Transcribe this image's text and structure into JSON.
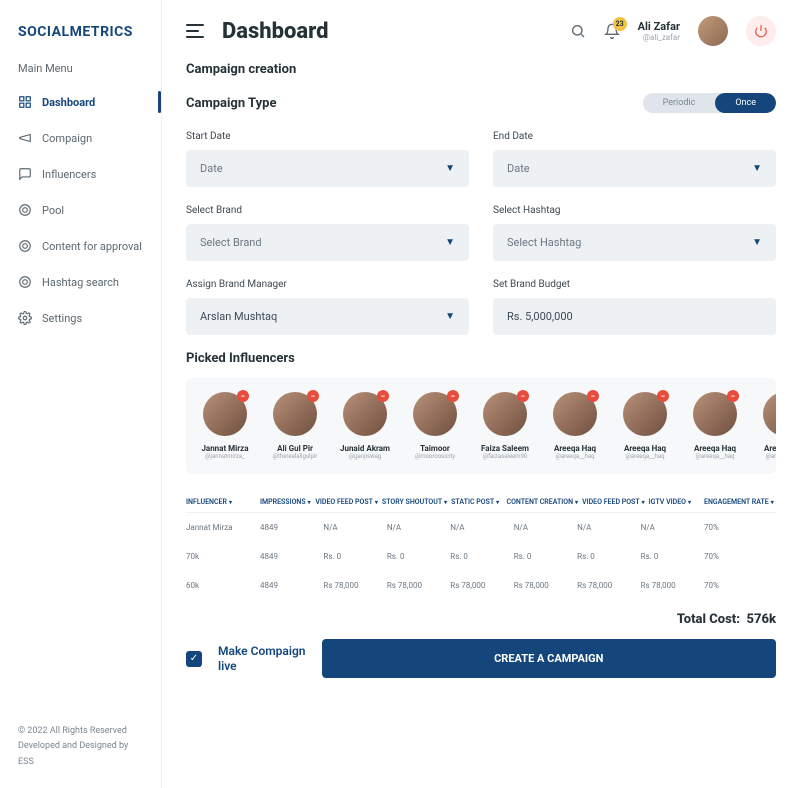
{
  "brand": "SOCIALMETRICS",
  "menu_header": "Main Menu",
  "nav": [
    {
      "label": "Dashboard"
    },
    {
      "label": "Compaign"
    },
    {
      "label": "Influencers"
    },
    {
      "label": "Pool"
    },
    {
      "label": "Content for approval"
    },
    {
      "label": "Hashtag search"
    },
    {
      "label": "Settings"
    }
  ],
  "footer": {
    "copyright": "© 2022 All Rights Reserved",
    "credit": "Developed and Designed by ESS"
  },
  "title": "Dashboard",
  "notifications": "23",
  "user": {
    "name": "Ali Zafar",
    "handle": "@ali_zafar"
  },
  "subtitle": "Campaign creation",
  "section": "Campaign Type",
  "toggle": {
    "a": "Periodic",
    "b": "Once"
  },
  "fields": {
    "start": {
      "label": "Start Date",
      "value": "Date"
    },
    "end": {
      "label": "End Date",
      "value": "Date"
    },
    "brand": {
      "label": "Select Brand",
      "value": "Select Brand"
    },
    "hashtag": {
      "label": "Select Hashtag",
      "value": "Select Hashtag"
    },
    "manager": {
      "label": "Assign Brand Manager",
      "value": "Arslan Mushtaq"
    },
    "budget": {
      "label": "Set Brand Budget",
      "value": "Rs. 5,000,000"
    }
  },
  "picked_label": "Picked Influencers",
  "infl": [
    {
      "name": "Jannat Mirza",
      "handle": "@jannatmirza_"
    },
    {
      "name": "Ali Gul Pir",
      "handle": "@therealaligulpir"
    },
    {
      "name": "Junaid Akram",
      "handle": "@ganjiswag"
    },
    {
      "name": "Taimoor",
      "handle": "@mooroosicity"
    },
    {
      "name": "Faiza Saleem",
      "handle": "@faizasaleem90"
    },
    {
      "name": "Areeqa Haq",
      "handle": "@areeqa__haq"
    },
    {
      "name": "Areeqa Haq",
      "handle": "@areeqa__haq"
    },
    {
      "name": "Areeqa Haq",
      "handle": "@areeqa__haq"
    },
    {
      "name": "Areeqa Haq",
      "handle": "@areeqa__haq"
    }
  ],
  "cols": [
    "INFLUENCER",
    "IMPRESSIONS",
    "VIDEO FEED POST",
    "STORY SHOUTOUT",
    "STATIC POST",
    "CONTENT CREATION",
    "VIDEO FEED POST",
    "IGTV VIDEO",
    "ENGAGEMENT RATE"
  ],
  "rows": [
    [
      "Jannat Mirza",
      "4849",
      "N/A",
      "N/A",
      "N/A",
      "N/A",
      "N/A",
      "N/A",
      "70%"
    ],
    [
      "70k",
      "4849",
      "Rs. 0",
      "Rs. 0",
      "Rs. 0",
      "Rs. 0",
      "Rs. 0",
      "Rs. 0",
      "70%"
    ],
    [
      "60k",
      "4849",
      "Rs 78,000",
      "Rs 78,000",
      "Rs 78,000",
      "Rs 78,000",
      "Rs 78,000",
      "Rs 78,000",
      "70%"
    ]
  ],
  "total": {
    "label": "Total Cost:",
    "value": "576k"
  },
  "live": {
    "l1": "Make Compaign",
    "l2": "live"
  },
  "cta": "CREATE A CAMPAIGN"
}
